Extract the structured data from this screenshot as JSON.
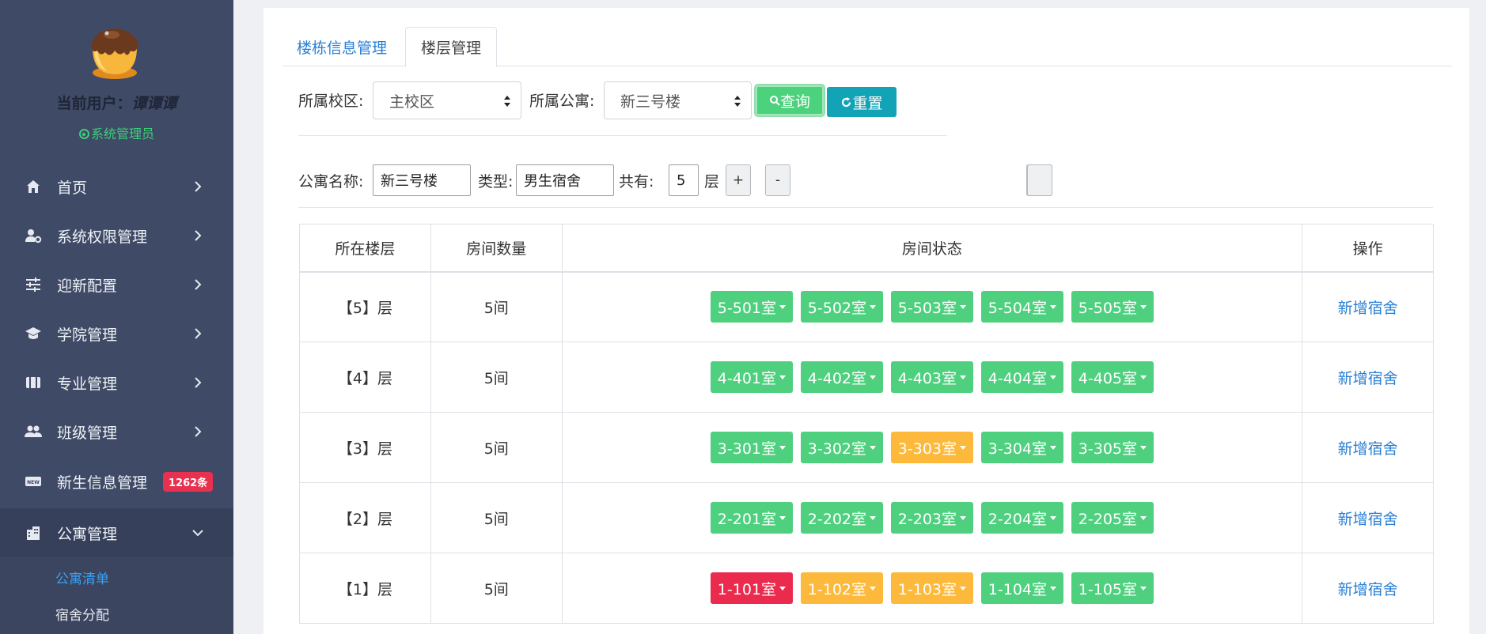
{
  "sidebar": {
    "user_prefix": "当前用户：",
    "user_name": "谭谭谭",
    "role": "系统管理员",
    "items": [
      {
        "label": "首页",
        "icon": "home-icon"
      },
      {
        "label": "系统权限管理",
        "icon": "user-settings-icon"
      },
      {
        "label": "迎新配置",
        "icon": "sliders-icon"
      },
      {
        "label": "学院管理",
        "icon": "graduation-cap-icon"
      },
      {
        "label": "专业管理",
        "icon": "book-icon"
      },
      {
        "label": "班级管理",
        "icon": "group-icon"
      },
      {
        "label": "新生信息管理",
        "icon": "new-badge-icon",
        "badge": "1262条"
      },
      {
        "label": "公寓管理",
        "icon": "building-icon"
      }
    ],
    "submenu": [
      "公寓清单",
      "宿舍分配"
    ]
  },
  "tabs": [
    "楼栋信息管理",
    "楼层管理"
  ],
  "filters": {
    "campus_label": "所属校区:",
    "campus_value": "主校区",
    "apartment_label": "所属公寓:",
    "apartment_value": "新三号楼",
    "query_label": "查询",
    "reset_label": "重置"
  },
  "info": {
    "name_label": "公寓名称:",
    "name_value": "新三号楼",
    "type_label": "类型:",
    "type_value": "男生宿舍",
    "total_label": "共有:",
    "total_value": "5",
    "unit": "层",
    "plus": "+",
    "minus": "-"
  },
  "table": {
    "headers": [
      "所在楼层",
      "房间数量",
      "房间状态",
      "操作"
    ],
    "action_label": "新增宿舍",
    "rows": [
      {
        "floor": "【5】层",
        "count": "5间",
        "rooms": [
          {
            "name": "5-501室",
            "status": "green"
          },
          {
            "name": "5-502室",
            "status": "green"
          },
          {
            "name": "5-503室",
            "status": "green"
          },
          {
            "name": "5-504室",
            "status": "green"
          },
          {
            "name": "5-505室",
            "status": "green"
          }
        ]
      },
      {
        "floor": "【4】层",
        "count": "5间",
        "rooms": [
          {
            "name": "4-401室",
            "status": "green"
          },
          {
            "name": "4-402室",
            "status": "green"
          },
          {
            "name": "4-403室",
            "status": "green"
          },
          {
            "name": "4-404室",
            "status": "green"
          },
          {
            "name": "4-405室",
            "status": "green"
          }
        ]
      },
      {
        "floor": "【3】层",
        "count": "5间",
        "rooms": [
          {
            "name": "3-301室",
            "status": "green"
          },
          {
            "name": "3-302室",
            "status": "green"
          },
          {
            "name": "3-303室",
            "status": "orange"
          },
          {
            "name": "3-304室",
            "status": "green"
          },
          {
            "name": "3-305室",
            "status": "green"
          }
        ]
      },
      {
        "floor": "【2】层",
        "count": "5间",
        "rooms": [
          {
            "name": "2-201室",
            "status": "green"
          },
          {
            "name": "2-202室",
            "status": "green"
          },
          {
            "name": "2-203室",
            "status": "green"
          },
          {
            "name": "2-204室",
            "status": "green"
          },
          {
            "name": "2-205室",
            "status": "green"
          }
        ]
      },
      {
        "floor": "【1】层",
        "count": "5间",
        "rooms": [
          {
            "name": "1-101室",
            "status": "red"
          },
          {
            "name": "1-102室",
            "status": "orange"
          },
          {
            "name": "1-103室",
            "status": "orange"
          },
          {
            "name": "1-104室",
            "status": "green"
          },
          {
            "name": "1-105室",
            "status": "green"
          }
        ]
      }
    ]
  },
  "colors": {
    "green": "#4fd07f",
    "orange": "#fdb93b",
    "red": "#ea2b4e",
    "sidebar": "#3f4a66",
    "link": "#2a7fd4"
  }
}
